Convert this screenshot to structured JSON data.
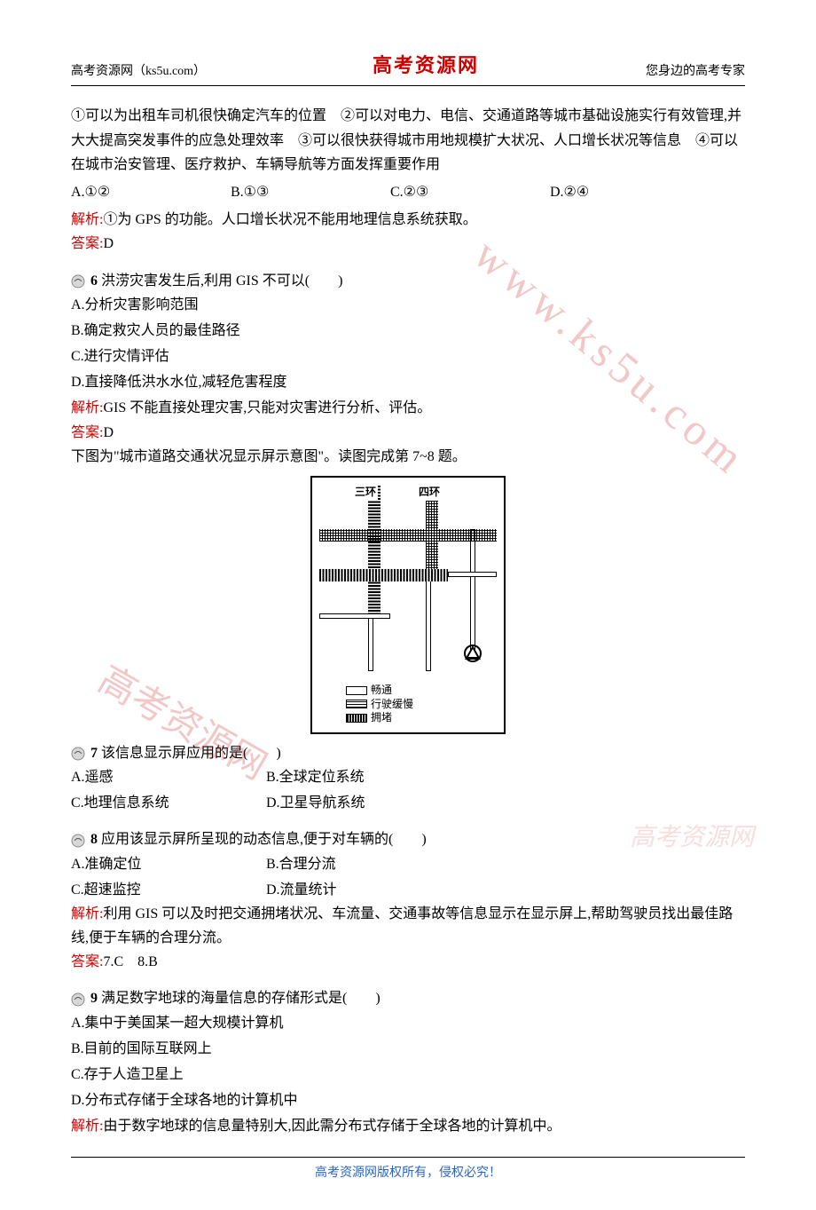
{
  "header": {
    "left": "高考资源网（ks5u.com）",
    "center": "高考资源网",
    "right": "您身边的高考专家"
  },
  "intro_context": "①可以为出租车司机很快确定汽车的位置　②可以对电力、电信、交通道路等城市基础设施实行有效管理,并大大提高突发事件的应急处理效率　③可以很快获得城市用地规模扩大状况、人口增长状况等信息　④可以在城市治安管理、医疗救护、车辆导航等方面发挥重要作用",
  "q5": {
    "options": {
      "a": "A.①②",
      "b": "B.①③",
      "c": "C.②③",
      "d": "D.②④"
    },
    "analysis_label": "解析:",
    "analysis_text": "①为 GPS 的功能。人口增长状况不能用地理信息系统获取。",
    "answer_label": "答案:",
    "answer_text": "D"
  },
  "q6": {
    "number": "6",
    "stem": " 洪涝灾害发生后,利用 GIS 不可以(　　)",
    "opts": {
      "a": "A.分析灾害影响范围",
      "b": "B.确定救灾人员的最佳路径",
      "c": "C.进行灾情评估",
      "d": "D.直接降低洪水水位,减轻危害程度"
    },
    "analysis_label": "解析:",
    "analysis_text": "GIS 不能直接处理灾害,只能对灾害进行分析、评估。",
    "answer_label": "答案:",
    "answer_text": "D"
  },
  "fig_intro": "下图为\"城市道路交通状况显示屏示意图\"。读图完成第 7~8 题。",
  "diagram": {
    "label1": "三环",
    "label2": "四环",
    "legend_clear": "畅通",
    "legend_slow": "行驶缓慢",
    "legend_jam": "拥堵"
  },
  "q7": {
    "number": "7",
    "stem": " 该信息显示屏应用的是(　　)",
    "opts": {
      "a": "A.遥感",
      "b": "B.全球定位系统",
      "c": "C.地理信息系统",
      "d": "D.卫星导航系统"
    }
  },
  "q8": {
    "number": "8",
    "stem": " 应用该显示屏所呈现的动态信息,便于对车辆的(　　)",
    "opts": {
      "a": "A.准确定位",
      "b": "B.合理分流",
      "c": "C.超速监控",
      "d": "D.流量统计"
    },
    "analysis_label": "解析:",
    "analysis_text": "利用 GIS 可以及时把交通拥堵状况、车流量、交通事故等信息显示在显示屏上,帮助驾驶员找出最佳路线,便于车辆的合理分流。",
    "answer_label": "答案:",
    "answer_text": "7.C　8.B"
  },
  "q9": {
    "number": "9",
    "stem": " 满足数字地球的海量信息的存储形式是(　　)",
    "opts": {
      "a": "A.集中于美国某一超大规模计算机",
      "b": "B.目前的国际互联网上",
      "c": "C.存于人造卫星上",
      "d": "D.分布式存储于全球各地的计算机中"
    },
    "analysis_label": "解析:",
    "analysis_text": "由于数字地球的信息量特别大,因此需分布式存储于全球各地的计算机中。"
  },
  "footer": "高考资源网版权所有，侵权必究！",
  "watermarks": {
    "wm1": "www.ks5u.com",
    "wm2": "高考资源网",
    "wm3": "高考资源网"
  }
}
